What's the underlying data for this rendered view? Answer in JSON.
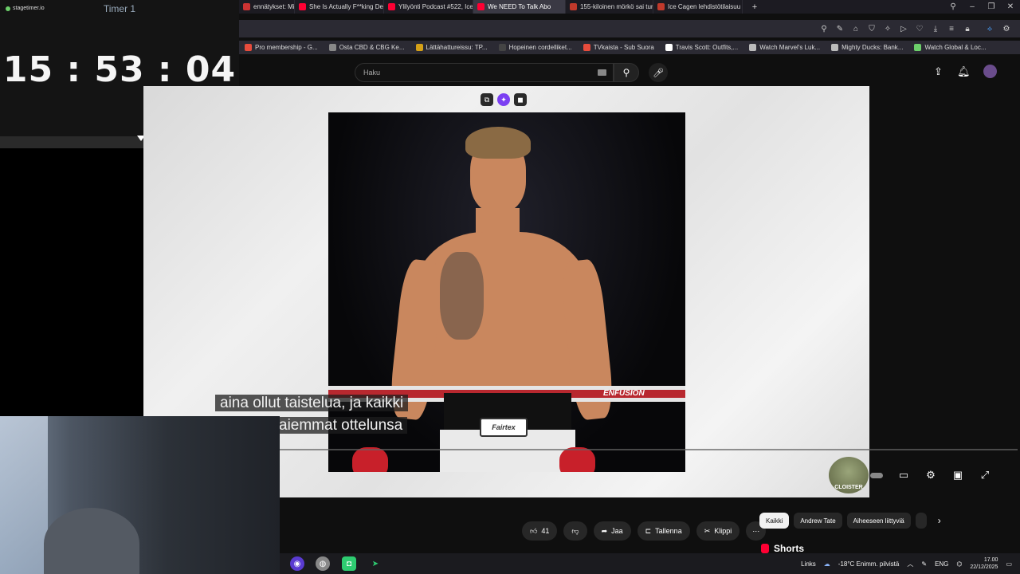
{
  "timer": {
    "brand": "stagetimer.io",
    "title": "Timer 1",
    "clock": "15 : 53 : 04",
    "progress": 0.4
  },
  "browser": {
    "tabs": [
      {
        "label": "ennätykset: Mitkä E",
        "color": "#cc3333"
      },
      {
        "label": "She Is Actually F**king De",
        "color": "#ff0033"
      },
      {
        "label": "Ylilyönti Podcast #522, Ice",
        "color": "#ff0033"
      },
      {
        "label": "We NEED To Talk Abo",
        "color": "#ff0033",
        "active": true
      },
      {
        "label": "155-kiloinen mörkö sai tur",
        "color": "#c0392b"
      },
      {
        "label": "Ice Cagen lehdistötilaisuu",
        "color": "#c0392b"
      }
    ],
    "new_tab": "+"
  },
  "bookmarks": [
    {
      "label": "Pro membership - G...",
      "color": "#e74c3c"
    },
    {
      "label": "Osta CBD & CBG Ke...",
      "color": "#888888"
    },
    {
      "label": "Lättähattureissu: TP...",
      "color": "#d4a017"
    },
    {
      "label": "Hopeinen cordelliket...",
      "color": "#444444"
    },
    {
      "label": "TVkaista - Sub Suora",
      "color": "#e74c3c"
    },
    {
      "label": "Travis Scott: Outfits,...",
      "color": "#ffffff"
    },
    {
      "label": "Watch Marvel's Luk...",
      "color": "#bbbbbb"
    },
    {
      "label": "Mighty Ducks: Bank...",
      "color": "#bbbbbb"
    },
    {
      "label": "Watch Global & Loc...",
      "color": "#6ccf6a"
    }
  ],
  "youtube": {
    "search_placeholder": "Haku",
    "subtitle_line1": "aina ollut taistelua, ja kaikki",
    "subtitle_line2": "aiemmat ottelunsa",
    "ring_text": "ENFUSION",
    "shorts_brand": "Fairtex",
    "watermark": "CLOISTER",
    "likes": "41",
    "share_label": "Jaa",
    "save_label": "Tallenna",
    "clip_label": "Klippi",
    "chips": [
      "Kaikki",
      "Andrew Tate",
      "Aiheeseen liittyviä"
    ],
    "shorts_label": "Shorts"
  },
  "taskbar": {
    "links_label": "Links",
    "weather": "-18°C  Enimm. pilvistä",
    "language": "ENG",
    "time": "17.00",
    "date": "22/12/2025"
  }
}
